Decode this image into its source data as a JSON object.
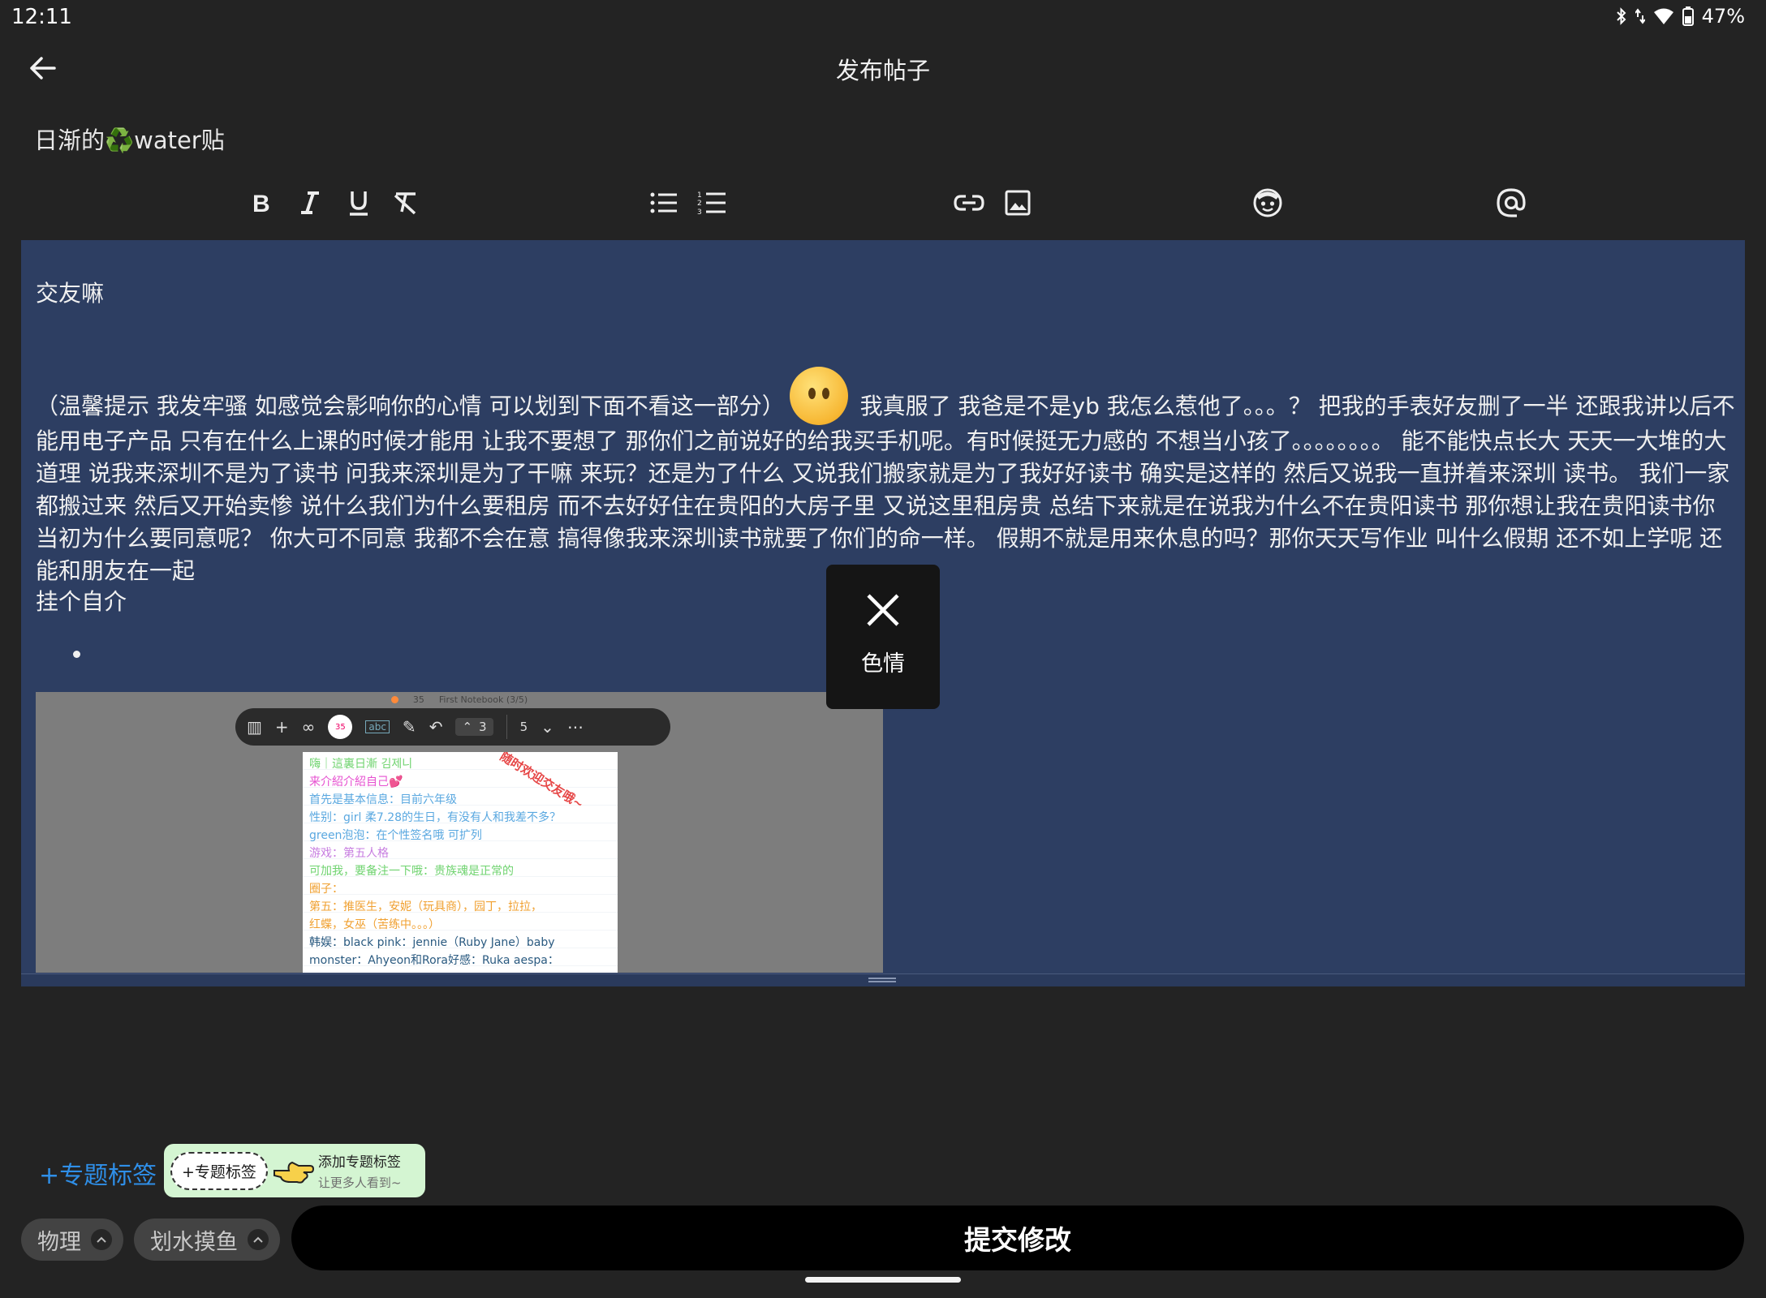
{
  "status": {
    "time": "12:11",
    "battery": "47%"
  },
  "header": {
    "title": "发布帖子"
  },
  "post": {
    "title": "日渐的♻️water贴"
  },
  "toolbar": {
    "items": [
      "bold-icon",
      "italic-icon",
      "underline-icon",
      "clear-format-icon",
      "bullet-list-icon",
      "numbered-list-icon",
      "link-icon",
      "image-icon",
      "emoji-icon",
      "mention-icon"
    ]
  },
  "editor": {
    "heading1": "交友嘛",
    "body_part1": "（温馨提示 我发牢骚 如感觉会影响你的心情 可以划到下面不看这一部分）",
    "body_part2": " 我真服了 我爸是不是yb 我怎么惹他了。。。？ 把我的手表好友删了一半 还跟我讲以后不能用电子产品 只有在什么上课的时候才能用 让我不要想了 那你们之前说好的给我买手机呢。有时候挺无力感的 不想当小孩了。。。。。。。。 能不能快点长大 天天一大堆的大道理 说我来深圳不是为了读书 问我来深圳是为了干嘛 来玩？还是为了什么 又说我们搬家就是为了我好好读书 确实是这样的 然后又说我一直拼着来深圳 读书。 我们一家都搬过来 然后又开始卖惨 说什么我们为什么要租房 而不去好好住在贵阳的大房子里 又说这里租房贵 总结下来就是在说我为什么不在贵阳读书 那你想让我在贵阳读书你当初为什么要同意呢？ 你大可不同意 我都不会在意 搞得像我来深圳读书就要了你们的命一样。 假期不就是用来休息的吗？那你天天写作业 叫什么假期 还不如上学呢 还能和朋友在一起",
    "heading2": "挂个自介"
  },
  "notebook": {
    "top_count": "35",
    "top_title": "First Notebook (3/5)",
    "brush_size": "35",
    "abc": "abc",
    "page_prev": "3",
    "page_next": "5",
    "stamp": "随时欢迎交友哦~",
    "lines": [
      "嗨｜這裏日漸 김제니",
      "来介紹介紹自己💕",
      "首先是基本信息：目前六年级",
      "性别：girl  柔7.28的生日，有没有人和我差不多？",
      "green泡泡：在个性签名哦 可扩列",
      "游戏：第五人格",
      "可加我，要备注一下哦：贵族魂是正常的",
      "圈子：",
      "第五：推医生，安妮（玩具商），园丁，拉拉，",
      "红蝶，女巫（苦练中。。。）",
      "韩娱：black pink：jennie（Ruby Jane）baby",
      "monster：Ahyeon和Rora好感：Ruka aespa："
    ],
    "line_colors": [
      "#6fd36f",
      "#e64fd0",
      "#5aa8e0",
      "#5aa8e0",
      "#5aa8e0",
      "#c77de0",
      "#6fd36f",
      "#f0a030",
      "#f0a030",
      "#f0a030",
      "#2a5a80",
      "#2a5a80"
    ]
  },
  "toast": {
    "text": "色情"
  },
  "topic": {
    "link": "+专题标签",
    "tip_chip": "+专题标签",
    "tip_title": "添加专题标签",
    "tip_sub": "让更多人看到~"
  },
  "tags": [
    "物理",
    "划水摸鱼"
  ],
  "submit": {
    "label": "提交修改"
  },
  "colors": {
    "editor_bg": "#2d3e62",
    "accent": "#2f8fe8",
    "tip_bg": "#d4f5d2"
  }
}
